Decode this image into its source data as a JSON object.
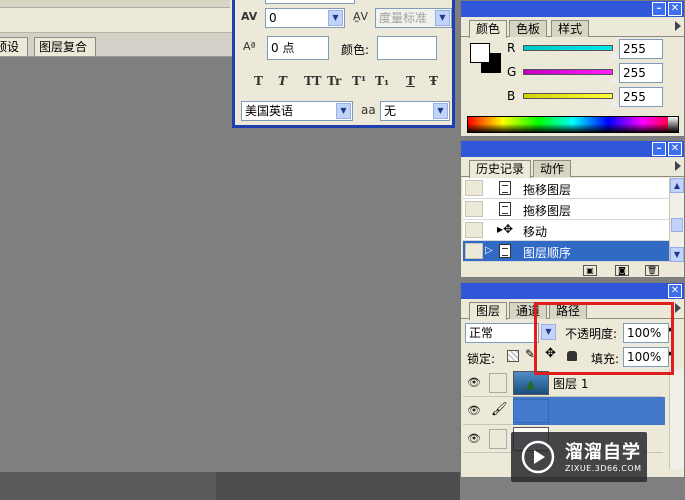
{
  "workspace": {
    "tabs": [
      "预设",
      "图层复合"
    ]
  },
  "character": {
    "kerning_value": "0",
    "tracking_value": "度量标准",
    "baseline_shift_value": "0 点",
    "color_label": "颜色:",
    "language_value": "美国英语",
    "aa_label": "aa",
    "antialias_value": "无",
    "style_glyphs": [
      "T",
      "T",
      "TT",
      "Tr",
      "T¹",
      "T₁",
      "T",
      "Ŧ"
    ]
  },
  "color_panel": {
    "tabs": [
      "颜色",
      "色板",
      "样式"
    ],
    "channels": [
      {
        "label": "R",
        "value": "255",
        "gradient": "#00c8c8"
      },
      {
        "label": "G",
        "value": "255",
        "gradient": "#e000e0"
      },
      {
        "label": "B",
        "value": "255",
        "gradient": "#e0e000"
      }
    ]
  },
  "history_panel": {
    "tabs": [
      "历史记录",
      "动作"
    ],
    "items": [
      {
        "label": "拖移图层",
        "selected": false
      },
      {
        "label": "拖移图层",
        "selected": false
      },
      {
        "label": "移动",
        "selected": false
      },
      {
        "label": "图层顺序",
        "selected": true
      }
    ]
  },
  "layers_panel": {
    "tabs": [
      "图层",
      "通道",
      "路径"
    ],
    "blend_mode": "正常",
    "opacity_label": "不透明度:",
    "opacity_value": "100%",
    "lock_label": "锁定:",
    "fill_label": "填充:",
    "fill_value": "100%",
    "layers": [
      {
        "name": "图层 1"
      }
    ]
  },
  "watermark": {
    "brand": "溜溜自学",
    "url": "ZIXUE.3D66.COM"
  },
  "colors": {
    "accent_blue": "#2f57d8",
    "selection": "#316ac5",
    "highlight_red": "#e01e1e"
  }
}
